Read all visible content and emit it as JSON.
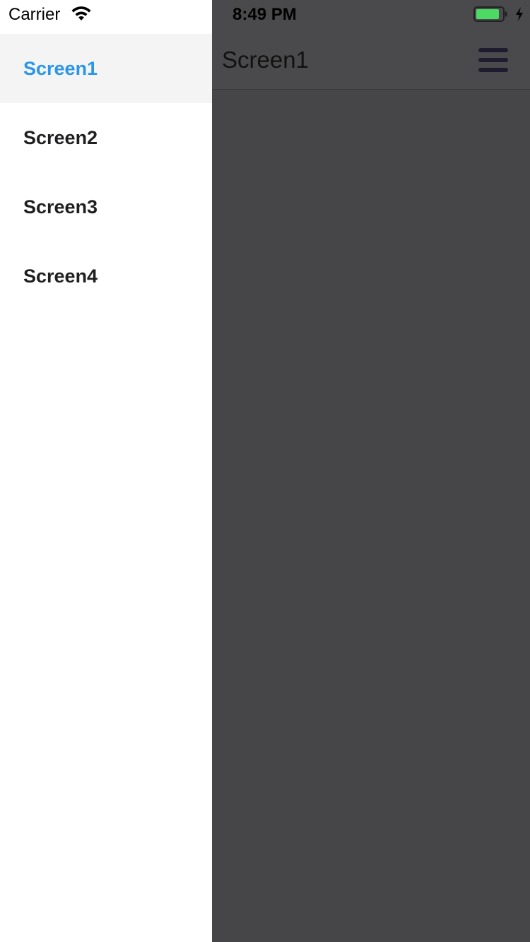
{
  "status_bar": {
    "carrier": "Carrier",
    "time": "8:49 PM",
    "icons": [
      "wifi-icon",
      "battery-icon",
      "charging-bolt-icon"
    ],
    "battery_color": "#4cd964"
  },
  "drawer": {
    "items": [
      {
        "label": "Screen1",
        "active": true
      },
      {
        "label": "Screen2",
        "active": false
      },
      {
        "label": "Screen3",
        "active": false
      },
      {
        "label": "Screen4",
        "active": false
      }
    ],
    "active_color": "#2a96e8"
  },
  "main": {
    "title": "Screen1",
    "menu_icon": "hamburger-menu-icon",
    "overlay_color": "#464648"
  }
}
